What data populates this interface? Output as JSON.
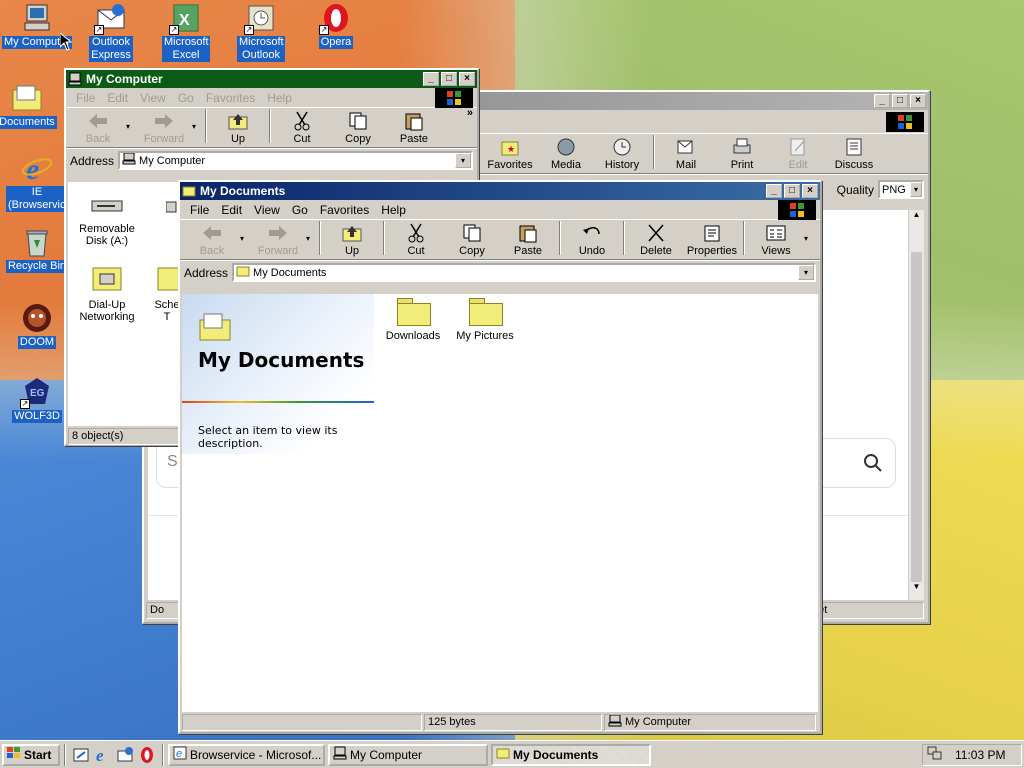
{
  "desktop": {
    "icons": [
      {
        "label": "My Computer"
      },
      {
        "label": "Outlook Express"
      },
      {
        "label": "Microsoft Excel"
      },
      {
        "label": "Microsoft Outlook"
      },
      {
        "label": "Opera"
      },
      {
        "label": "Documents"
      },
      {
        "label": "IE (Browservice)"
      },
      {
        "label": "Recycle Bin"
      },
      {
        "label": "DOOM"
      },
      {
        "label": "WOLF3D"
      }
    ]
  },
  "browser_window": {
    "toolbar": [
      "Favorites",
      "Media",
      "History",
      "Mail",
      "Print",
      "Edit",
      "Discuss"
    ],
    "quality_label": "Quality",
    "quality_value": "PNG",
    "status_right": "net",
    "status_left": "Do"
  },
  "my_computer_window": {
    "title": "My Computer",
    "menu": [
      "File",
      "Edit",
      "View",
      "Go",
      "Favorites",
      "Help"
    ],
    "toolbar": [
      "Back",
      "Forward",
      "Up",
      "Cut",
      "Copy",
      "Paste"
    ],
    "more": "»",
    "address_label": "Address",
    "address_value": "My Computer",
    "items": [
      {
        "label": "Removable Disk (A:)"
      },
      {
        "label": "Dial-Up Networking"
      },
      {
        "label": "Sche T"
      }
    ],
    "status": "8 object(s)"
  },
  "my_documents_window": {
    "title": "My Documents",
    "menu": [
      "File",
      "Edit",
      "View",
      "Go",
      "Favorites",
      "Help"
    ],
    "toolbar": [
      "Back",
      "Forward",
      "Up",
      "Cut",
      "Copy",
      "Paste",
      "Undo",
      "Delete",
      "Properties",
      "Views"
    ],
    "address_label": "Address",
    "address_value": "My Documents",
    "panel_title": "My Documents",
    "panel_hint": "Select an item to view its description.",
    "folders": [
      {
        "label": "Downloads"
      },
      {
        "label": "My Pictures"
      }
    ],
    "status_size": "125 bytes",
    "status_location": "My Computer"
  },
  "taskbar": {
    "start_label": "Start",
    "tasks": [
      {
        "label": "Browservice - Microsof..."
      },
      {
        "label": "My Computer"
      },
      {
        "label": "My Documents"
      }
    ],
    "clock": "11:03 PM"
  }
}
